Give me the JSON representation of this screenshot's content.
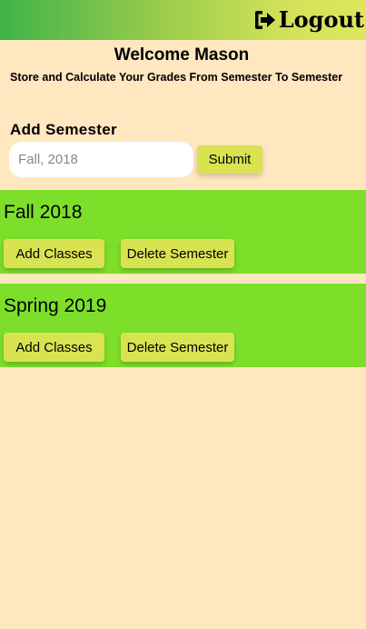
{
  "header": {
    "logout_label": "Logout",
    "logout_icon": "sign-out-icon",
    "gradient_colors": [
      "#3fb34a",
      "#dde65e"
    ]
  },
  "welcome": "Welcome Mason",
  "subtitle": "Store and Calculate Your Grades From Semester To Semester",
  "add_semester": {
    "heading": "Add Semester",
    "input_placeholder": "Fall, 2018",
    "input_value": "",
    "submit_label": "Submit"
  },
  "semesters": [
    {
      "title": "Fall 2018",
      "add_label": "Add Classes",
      "delete_label": "Delete Semester"
    },
    {
      "title": "Spring 2019",
      "add_label": "Add Classes",
      "delete_label": "Delete Semester"
    }
  ],
  "colors": {
    "background": "#ffe7c0",
    "card": "#7ddf2a",
    "button": "#d9e352"
  }
}
